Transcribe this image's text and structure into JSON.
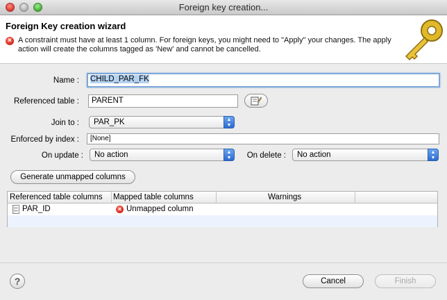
{
  "window": {
    "title": "Foreign key creation..."
  },
  "header": {
    "title": "Foreign Key creation wizard",
    "error_message": "A constraint must have at least 1 column. For foreign keys, you might need to \"Apply\" your changes. The apply action will create the columns tagged as 'New' and cannot be cancelled."
  },
  "form": {
    "name_label": "Name :",
    "name_value": "CHILD_PAR_FK",
    "referenced_table_label": "Referenced table :",
    "referenced_table_value": "PARENT",
    "join_to_label": "Join to :",
    "join_to_value": "PAR_PK",
    "enforced_by_label": "Enforced by index :",
    "enforced_by_value": "[None]",
    "on_update_label": "On update :",
    "on_update_value": "No action",
    "on_delete_label": "On delete :",
    "on_delete_value": "No action",
    "generate_button": "Generate unmapped columns"
  },
  "table": {
    "headers": [
      "Referenced table columns",
      "Mapped table columns",
      "Warnings"
    ],
    "rows": [
      {
        "referenced": "PAR_ID",
        "mapped": "Unmapped column",
        "warnings": ""
      }
    ]
  },
  "footer": {
    "help_label": "?",
    "cancel_label": "Cancel",
    "finish_label": "Finish"
  },
  "colors": {
    "accent_blue": "#2d6bd0",
    "error_red": "#d6281c",
    "selection": "#b5d3f3"
  },
  "icons": [
    "close-window-icon",
    "minimize-window-icon",
    "zoom-window-icon",
    "error-icon",
    "key-icon",
    "browse-table-icon",
    "column-icon",
    "help-icon"
  ]
}
